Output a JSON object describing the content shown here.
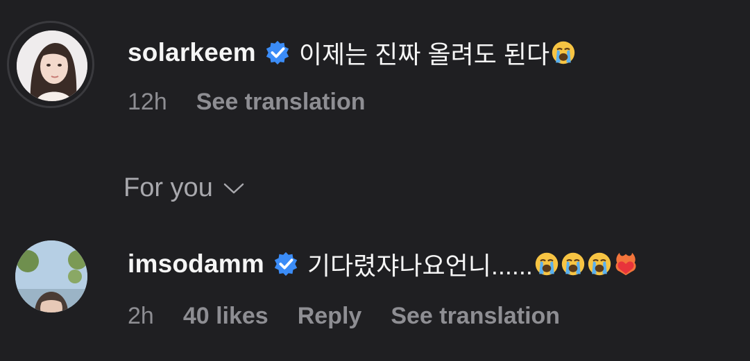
{
  "comments": [
    {
      "username": "solarkeem",
      "text": "이제는 진짜 올려도 된다",
      "emojis": [
        "crying-face"
      ],
      "time": "12h",
      "see_translation": "See translation"
    },
    {
      "username": "imsodamm",
      "text": "기다렸쟈나요언니......",
      "emojis": [
        "crying-face",
        "crying-face",
        "crying-face",
        "heart-on-fire"
      ],
      "time": "2h",
      "likes": "40 likes",
      "reply": "Reply",
      "see_translation": "See translation"
    }
  ],
  "section": {
    "label": "For you",
    "icon": "chevron-down-icon"
  },
  "colors": {
    "background": "#1f1f22",
    "verified": "#3b8cf7",
    "meta_text": "#8e8e93"
  }
}
